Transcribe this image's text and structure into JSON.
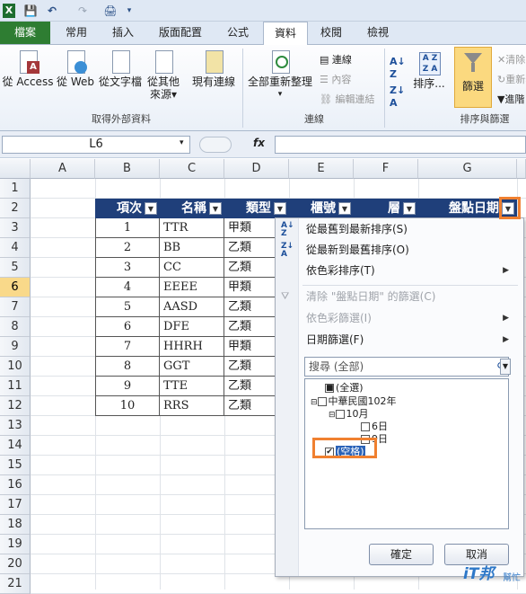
{
  "qat": {
    "excel": "X",
    "save": "💾",
    "undo": "↶",
    "redo": "↷",
    "print": "🖨"
  },
  "tabs": [
    "檔案",
    "常用",
    "插入",
    "版面配置",
    "公式",
    "資料",
    "校閱",
    "檢視"
  ],
  "ribbon": {
    "access": "從 Access",
    "web": "從 Web",
    "text": "從文字檔",
    "other1": "從其他",
    "other2": "來源",
    "existing": "現有連線",
    "refresh": "全部重新整理",
    "conn": "連線",
    "props": "內容",
    "editlinks": "編輯連結",
    "sort": "排序...",
    "filter": "篩選",
    "clear": "清除",
    "reapply": "重新套用",
    "advanced": "進階",
    "group_external": "取得外部資料",
    "group_conn": "連線",
    "group_sort": "排序與篩選"
  },
  "namebox": "L6",
  "fx": "fx",
  "columns": [
    "A",
    "B",
    "C",
    "D",
    "E",
    "F",
    "G"
  ],
  "rows": [
    "1",
    "2",
    "3",
    "4",
    "5",
    "6",
    "7",
    "8",
    "9",
    "10",
    "11",
    "12",
    "13",
    "14",
    "15",
    "16",
    "17",
    "18",
    "19",
    "20",
    "21"
  ],
  "headers": [
    "項次",
    "名稱",
    "類型",
    "櫃號",
    "層",
    "盤點日期"
  ],
  "table": [
    [
      "1",
      "TTR",
      "甲類"
    ],
    [
      "2",
      "BB",
      "乙類"
    ],
    [
      "3",
      "CC",
      "乙類"
    ],
    [
      "4",
      "EEEE",
      "甲類"
    ],
    [
      "5",
      "AASD",
      "乙類"
    ],
    [
      "6",
      "DFE",
      "乙類"
    ],
    [
      "7",
      "HHRH",
      "甲類"
    ],
    [
      "8",
      "GGT",
      "乙類"
    ],
    [
      "9",
      "TTE",
      "乙類"
    ],
    [
      "10",
      "RRS",
      "乙類"
    ]
  ],
  "menu": {
    "sort_asc": "從最舊到最新排序(S)",
    "sort_desc": "從最新到最舊排序(O)",
    "sort_color": "依色彩排序(T)",
    "clear_filter": "清除 \"盤點日期\" 的篩選(C)",
    "filter_color": "依色彩篩選(I)",
    "date_filter": "日期篩選(F)",
    "search_placeholder": "搜尋 (全部)",
    "tree": {
      "all": "(全選)",
      "year": "中華民國102年",
      "month": "10月",
      "d6": "6日",
      "d9": "9日",
      "blank": "(空格)"
    },
    "ok": "確定",
    "cancel": "取消"
  },
  "watermark": {
    "logo": "iT邦",
    "sub": "幫忙"
  },
  "colors": {
    "header_bg": "#1f3f7a",
    "file_tab": "#2e7d32",
    "highlight": "#f08030",
    "selected_row": "#f9d98a"
  }
}
